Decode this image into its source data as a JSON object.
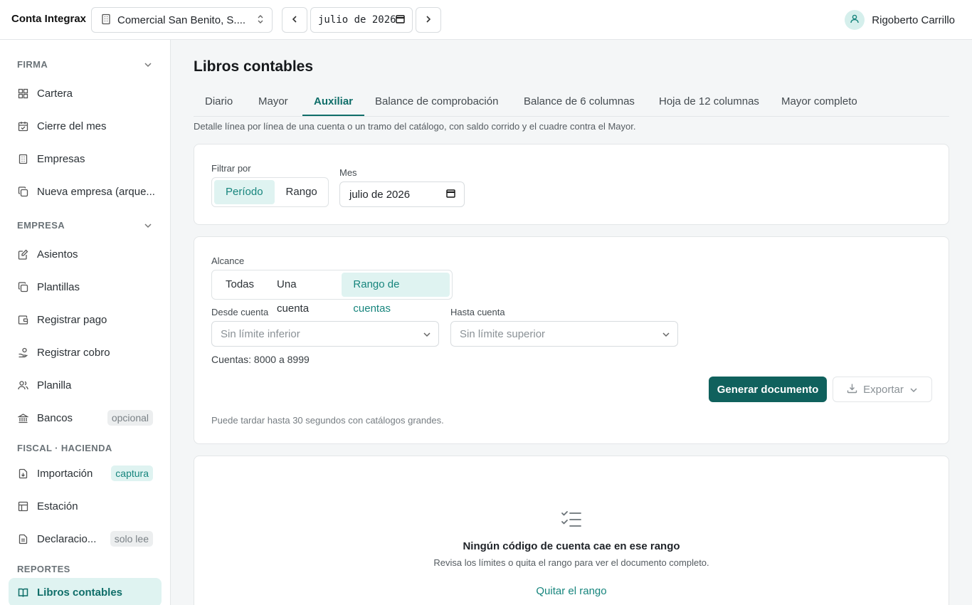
{
  "app": {
    "title": "Conta Integrax"
  },
  "header": {
    "company": "Comercial San Benito, S....",
    "month": "julio de 2026",
    "user": "Rigoberto Carrillo"
  },
  "sidebar": {
    "sections": [
      {
        "title": "FIRMA",
        "collapsible": true
      },
      {
        "title": "EMPRESA",
        "collapsible": true
      },
      {
        "title": "FISCAL · HACIENDA",
        "collapsible": false
      },
      {
        "title": "REPORTES",
        "collapsible": false
      }
    ],
    "items": [
      {
        "label": "Cartera",
        "icon": "grid-icon"
      },
      {
        "label": "Cierre del mes",
        "icon": "calendar-check-icon"
      },
      {
        "label": "Empresas",
        "icon": "building-icon"
      },
      {
        "label": "Nueva empresa (arque...",
        "icon": "copy-icon"
      },
      {
        "label": "Asientos",
        "icon": "edit-note-icon"
      },
      {
        "label": "Plantillas",
        "icon": "copy-icon"
      },
      {
        "label": "Registrar pago",
        "icon": "wallet-icon"
      },
      {
        "label": "Registrar cobro",
        "icon": "hand-coins-icon"
      },
      {
        "label": "Planilla",
        "icon": "users-icon"
      },
      {
        "label": "Bancos",
        "icon": "bank-icon",
        "badge": "opcional"
      },
      {
        "label": "Importación",
        "icon": "file-import-icon",
        "badge": "captura"
      },
      {
        "label": "Estación",
        "icon": "table-icon"
      },
      {
        "label": "Declaracio...",
        "icon": "file-text-icon",
        "badge": "solo lee"
      },
      {
        "label": "Libros contables",
        "icon": "book-open-icon",
        "active": true
      }
    ]
  },
  "main": {
    "title": "Libros contables",
    "tabs": [
      {
        "label": "Diario"
      },
      {
        "label": "Mayor"
      },
      {
        "label": "Auxiliar",
        "active": true
      },
      {
        "label": "Balance de comprobación"
      },
      {
        "label": "Balance de 6 columnas"
      },
      {
        "label": "Hoja de 12 columnas"
      },
      {
        "label": "Mayor completo"
      }
    ],
    "description": "Detalle línea por línea de una cuenta o un tramo del catálogo, con saldo corrido y el cuadre contra el Mayor."
  },
  "filter": {
    "label": "Filtrar por",
    "options": [
      "Período",
      "Rango"
    ],
    "selected": "Período",
    "month_label": "Mes",
    "month_value": "julio de 2026"
  },
  "scope": {
    "label": "Alcance",
    "options": [
      "Todas",
      "Una cuenta",
      "Rango de cuentas"
    ],
    "selected": "Rango de cuentas",
    "from_label": "Desde cuenta",
    "from_placeholder": "Sin límite inferior",
    "to_label": "Hasta cuenta",
    "to_placeholder": "Sin límite superior",
    "accounts_hint": "Cuentas: 8000 a 8999",
    "generate_label": "Generar documento",
    "export_label": "Exportar",
    "note": "Puede tardar hasta 30 segundos con catálogos grandes."
  },
  "empty_state": {
    "title": "Ningún código de cuenta cae en ese rango",
    "subtitle": "Revisa los límites o quita el rango para ver el documento completo.",
    "action": "Quitar el rango"
  },
  "colors": {
    "accent": "#10615d",
    "accent_text": "#17857d",
    "accent_bg": "#dff3f1"
  }
}
